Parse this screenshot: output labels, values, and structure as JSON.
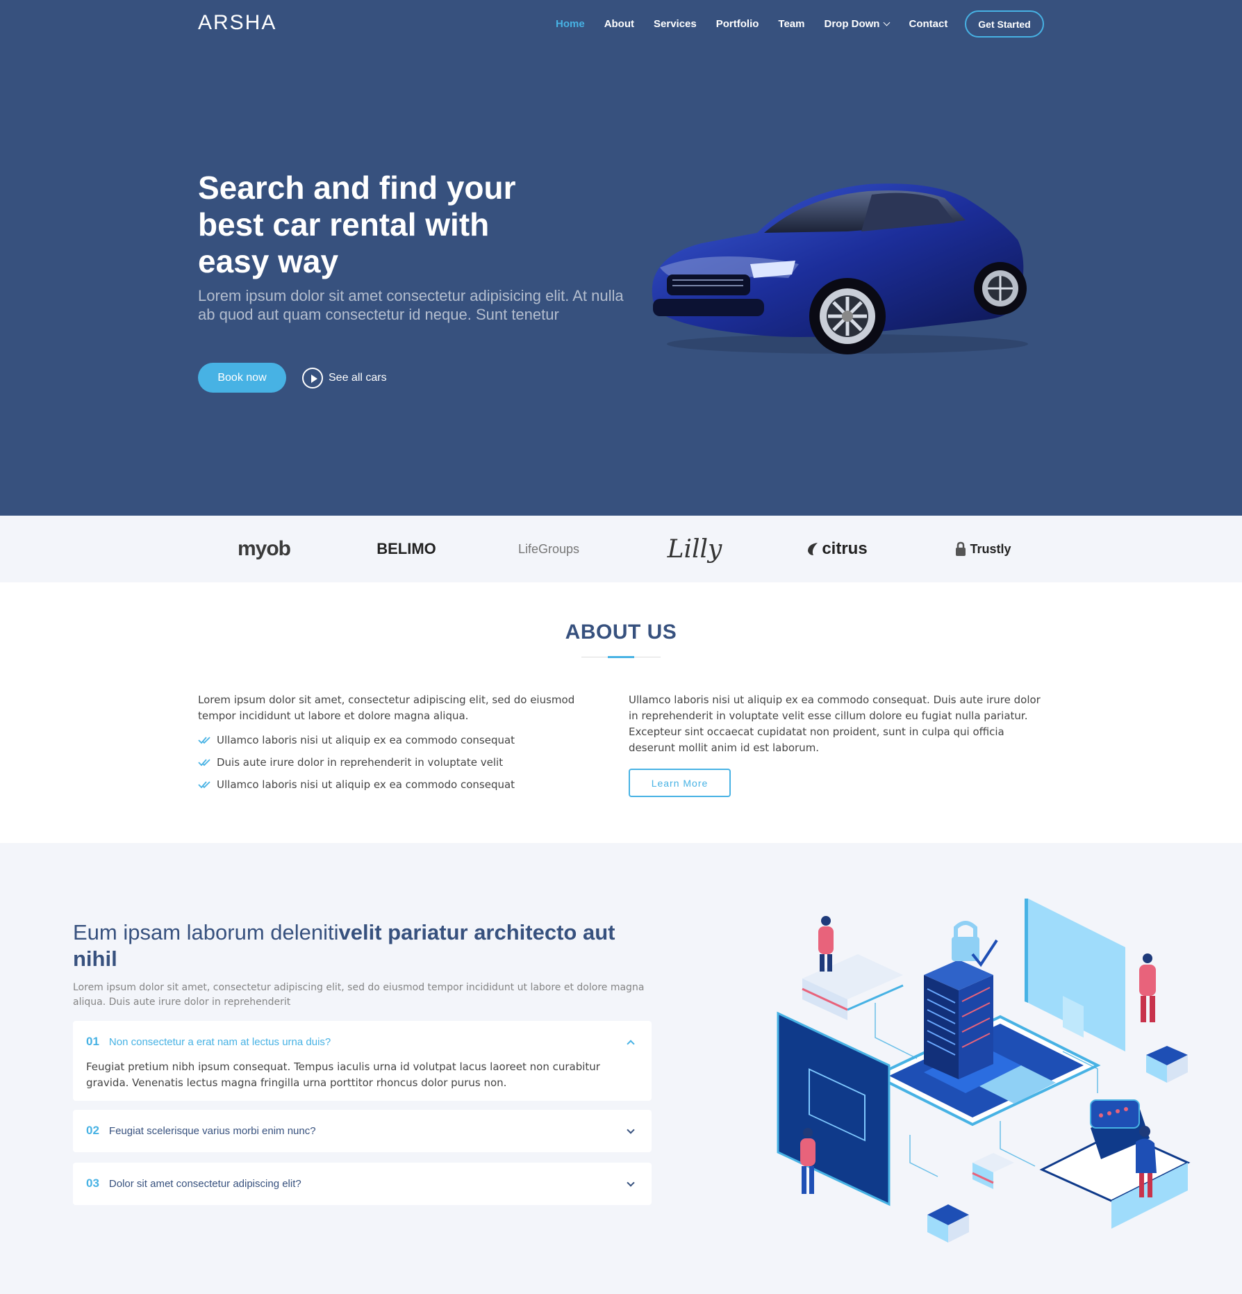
{
  "header": {
    "logo": "ARSHA",
    "nav": [
      "Home",
      "About",
      "Services",
      "Portfolio",
      "Team",
      "Drop Down",
      "Contact"
    ],
    "cta": "Get Started"
  },
  "hero": {
    "title": "Search and find your best car rental with easy way",
    "subtitle": "Lorem ipsum dolor sit amet consectetur adipisicing elit. At nulla ab quod aut quam consectetur id neque. Sunt tenetur",
    "book_label": "Book now",
    "video_label": "See all cars"
  },
  "clients": {
    "logos": [
      "myob",
      "BELIMO",
      "LifeGroups",
      "Lilly",
      "citrus",
      "Trustly"
    ]
  },
  "about": {
    "title": "ABOUT US",
    "left_text": "Lorem ipsum dolor sit amet, consectetur adipiscing elit, sed do eiusmod tempor incididunt ut labore et dolore magna aliqua.",
    "list": [
      "Ullamco laboris nisi ut aliquip ex ea commodo consequat",
      "Duis aute irure dolor in reprehenderit in voluptate velit",
      "Ullamco laboris nisi ut aliquip ex ea commodo consequat"
    ],
    "right_text": "Ullamco laboris nisi ut aliquip ex ea commodo consequat. Duis aute irure dolor in reprehenderit in voluptate velit esse cillum dolore eu fugiat nulla pariatur. Excepteur sint occaecat cupidatat non proident, sunt in culpa qui officia deserunt mollit anim id est laborum.",
    "button": "Learn More"
  },
  "why_us": {
    "title_light": "Eum ipsam laborum deleniti",
    "title_bold": "velit pariatur architecto aut nihil",
    "subtitle": "Lorem ipsum dolor sit amet, consectetur adipiscing elit, sed do eiusmod tempor incididunt ut labore et dolore magna aliqua. Duis aute irure dolor in reprehenderit",
    "faqs": [
      {
        "num": "01",
        "question": "Non consectetur a erat nam at lectus urna duis?",
        "answer": "Feugiat pretium nibh ipsum consequat. Tempus iaculis urna id volutpat lacus laoreet non curabitur gravida. Venenatis lectus magna fringilla urna porttitor rhoncus dolor purus non."
      },
      {
        "num": "02",
        "question": "Feugiat scelerisque varius morbi enim nunc?"
      },
      {
        "num": "03",
        "question": "Dolor sit amet consectetur adipiscing elit?"
      }
    ]
  },
  "colors": {
    "primary": "#37517e",
    "accent": "#47b2e4",
    "light_bg": "#f3f5fa"
  }
}
